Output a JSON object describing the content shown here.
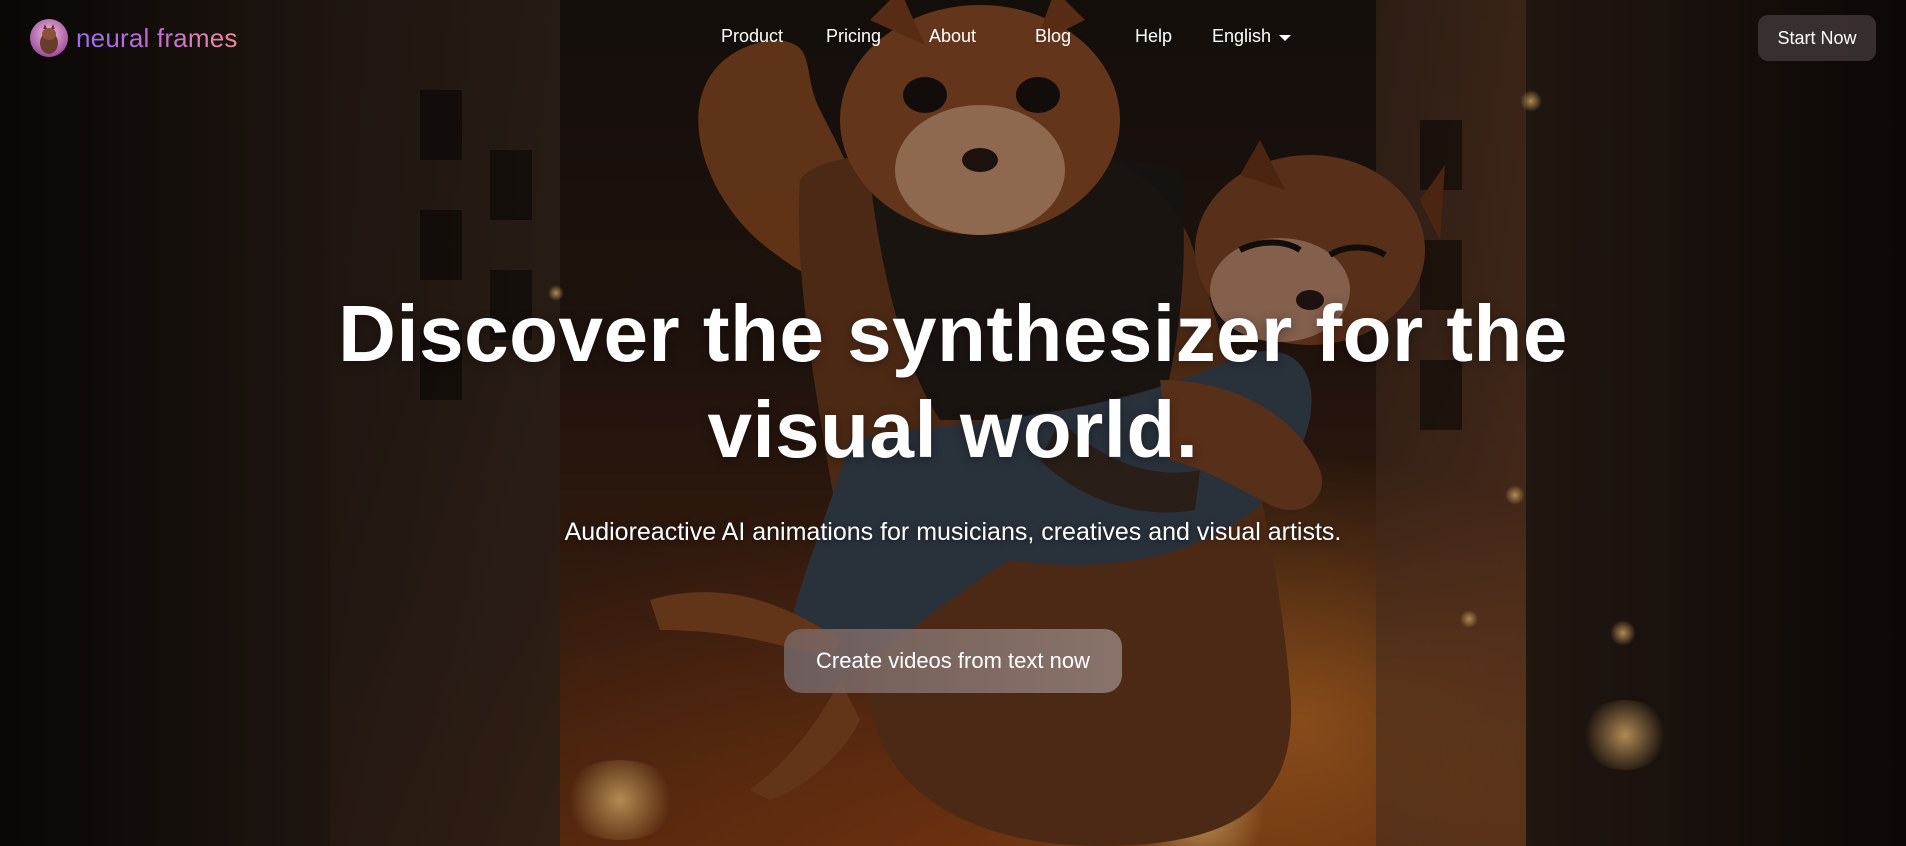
{
  "header": {
    "logo_text": "neural frames",
    "logo_icon": "squirrel-avatar-icon",
    "nav": [
      {
        "id": "product",
        "label": "Product"
      },
      {
        "id": "pricing",
        "label": "Pricing"
      },
      {
        "id": "about",
        "label": "About"
      },
      {
        "id": "blog",
        "label": "Blog"
      },
      {
        "id": "help",
        "label": "Help"
      }
    ],
    "language": {
      "selected": "English",
      "icon": "caret-down-icon"
    },
    "start_button": "Start Now"
  },
  "hero": {
    "headline_line1": "Discover the synthesizer for the",
    "headline_line2": "visual world.",
    "subheadline": "Audioreactive AI animations for musicians, creatives and visual artists.",
    "cta_button": "Create videos from text now",
    "background_image": "squirrel-carrying-squirrel-in-burning-city"
  },
  "colors": {
    "logo_gradient_start": "#9b6cf0",
    "logo_gradient_end": "#f08b9a",
    "text": "#ffffff",
    "start_button_bg": "#3e3434",
    "cta_button_bg": "#86706c"
  }
}
